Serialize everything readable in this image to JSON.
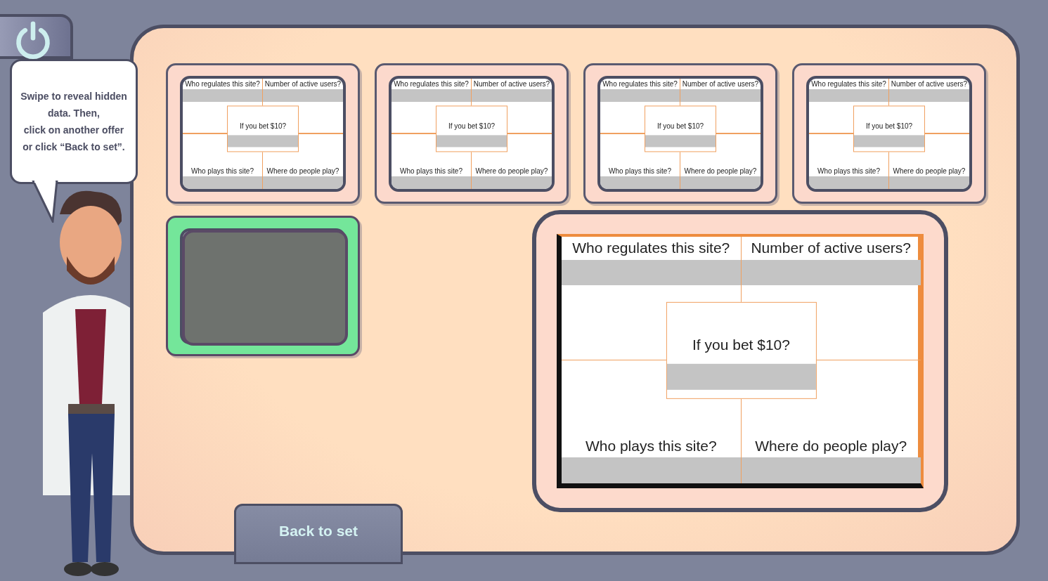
{
  "hint": {
    "lines": [
      "Swipe to reveal hidden",
      "data. Then,",
      "click on another offer",
      "or click “Back to set”."
    ]
  },
  "cards": [
    {
      "selected": false,
      "top_left": "Who regulates this site?",
      "top_right": "Number of active users?",
      "center": "If you bet $10?",
      "bottom_left": "Who plays this site?",
      "bottom_right": "Where do people play?"
    },
    {
      "selected": false,
      "top_left": "Who regulates this site?",
      "top_right": "Number of active users?",
      "center": "If you bet $10?",
      "bottom_left": "Who plays this site?",
      "bottom_right": "Where do people play?"
    },
    {
      "selected": false,
      "top_left": "Who regulates this site?",
      "top_right": "Number of active users?",
      "center": "If you bet $10?",
      "bottom_left": "Who plays this site?",
      "bottom_right": "Where do people play?"
    },
    {
      "selected": false,
      "top_left": "Who regulates this site?",
      "top_right": "Number of active users?",
      "center": "If you bet $10?",
      "bottom_left": "Who plays this site?",
      "bottom_right": "Where do people play?"
    },
    {
      "selected": true
    }
  ],
  "preview": {
    "top_left": "Who regulates this site?",
    "top_right": "Number of active users?",
    "center": "If you bet $10?",
    "bottom_left": "Who plays this site?",
    "bottom_right": "Where do people play?"
  },
  "back_button": "Back to set"
}
